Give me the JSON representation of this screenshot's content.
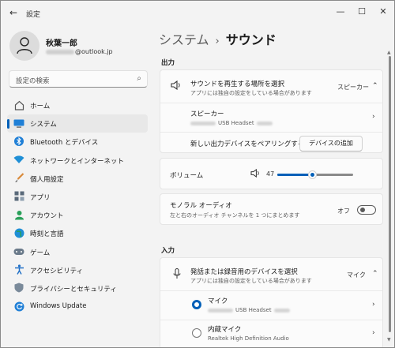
{
  "window": {
    "title": "設定"
  },
  "user": {
    "name": "秋葉一郎",
    "email_domain": "@outlook.jp"
  },
  "search": {
    "placeholder": "設定の検索"
  },
  "nav": [
    {
      "label": "ホーム",
      "icon": "home-icon",
      "active": false
    },
    {
      "label": "システム",
      "icon": "system-icon",
      "active": true
    },
    {
      "label": "Bluetooth とデバイス",
      "icon": "bluetooth-icon",
      "active": false
    },
    {
      "label": "ネットワークとインターネット",
      "icon": "wifi-icon",
      "active": false
    },
    {
      "label": "個人用設定",
      "icon": "brush-icon",
      "active": false
    },
    {
      "label": "アプリ",
      "icon": "apps-icon",
      "active": false
    },
    {
      "label": "アカウント",
      "icon": "account-icon",
      "active": false
    },
    {
      "label": "時刻と言語",
      "icon": "globe-icon",
      "active": false
    },
    {
      "label": "ゲーム",
      "icon": "gamepad-icon",
      "active": false
    },
    {
      "label": "アクセシビリティ",
      "icon": "accessibility-icon",
      "active": false
    },
    {
      "label": "プライバシーとセキュリティ",
      "icon": "shield-icon",
      "active": false
    },
    {
      "label": "Windows Update",
      "icon": "windows-update-icon",
      "active": false
    }
  ],
  "breadcrumb": {
    "parent": "システム",
    "separator": "›",
    "current": "サウンド"
  },
  "output": {
    "section_title": "出力",
    "choose_title": "サウンドを再生する場所を選択",
    "choose_sub": "アプリには独自の設定をしている場合があります",
    "choose_value": "スピーカー",
    "speaker_title": "スピーカー",
    "speaker_sub": "USB Headset",
    "pair_label": "新しい出力デバイスをペアリングする",
    "add_device_button": "デバイスの追加",
    "volume_label": "ボリューム",
    "volume_value": "47",
    "volume_level": 47,
    "mono_title": "モノラル オーディオ",
    "mono_sub": "左と右のオーディオ チャンネルを 1 つにまとめます",
    "mono_state": "オフ"
  },
  "input": {
    "section_title": "入力",
    "choose_title": "発話または録音用のデバイスを選択",
    "choose_sub": "アプリには独自の設定をしている場合があります",
    "choose_value": "マイク",
    "mic_title": "マイク",
    "mic_sub": "USB Headset",
    "internal_title": "内蔵マイク",
    "internal_sub": "Realtek High Definition Audio"
  },
  "colors": {
    "accent": "#005fb8",
    "window_bg": "#f3f3f3",
    "card_bg": "#fbfbfb"
  }
}
